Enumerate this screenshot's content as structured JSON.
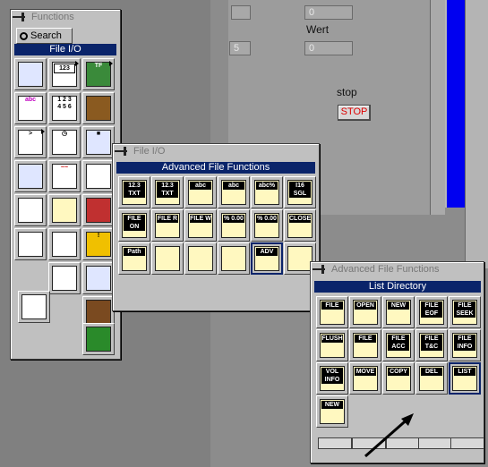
{
  "front_panel": {
    "field1_value": "0",
    "field2_value": "0",
    "field3_value": "5",
    "wert_label": "Wert",
    "stop_label": "stop",
    "stop_button": "STOP"
  },
  "functions_palette": {
    "title": "Functions",
    "search_label": "Search",
    "section": "File I/O"
  },
  "file_io_palette": {
    "title": "File I/O",
    "section": "Advanced File Functions",
    "icons": [
      "12.3 TXT",
      "12.3 TXT",
      "abc",
      "abc",
      "abc%",
      "I16 SGL",
      "FILE ON",
      "FILE R",
      "FILE W",
      "% 0.00",
      "% 0.00",
      "CLOSE",
      "Path",
      "",
      "",
      "",
      "ADV",
      ""
    ]
  },
  "adv_file_palette": {
    "title": "Advanced File Functions",
    "section": "List Directory",
    "icons": [
      "FILE",
      "OPEN",
      "NEW",
      "FILE EOF",
      "FILE SEEK",
      "FLUSH",
      "FILE",
      "FILE ACC",
      "FILE T&C",
      "FILE INFO",
      "VOL INFO",
      "MOVE",
      "COPY",
      "DEL",
      "LIST",
      "NEW"
    ]
  }
}
